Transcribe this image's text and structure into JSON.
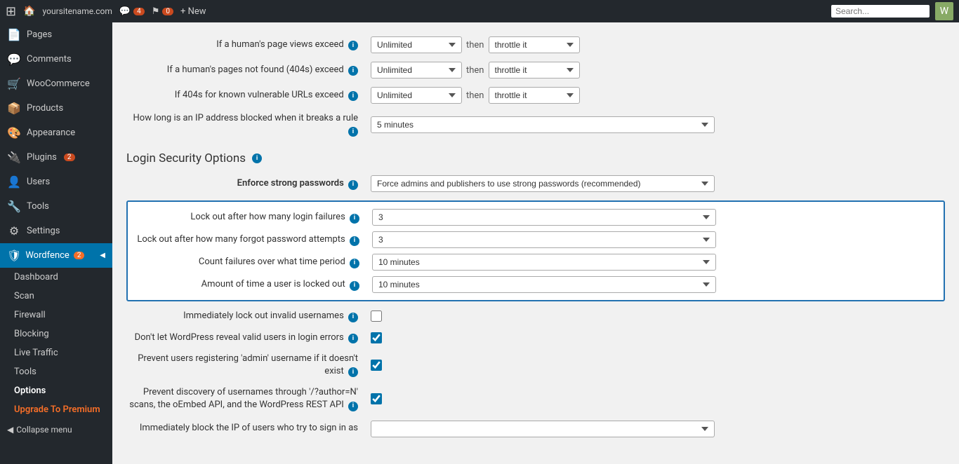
{
  "adminBar": {
    "wpLogo": "⊞",
    "siteName": "yoursitename.com",
    "commentsBubble": "4",
    "notifBubble": "0",
    "newLabel": "+ New",
    "searchPlaceholder": "Search...",
    "userDisplay": "W"
  },
  "sidebar": {
    "pages": "Pages",
    "comments": "Comments",
    "woocommerce": "WooCommerce",
    "products": "Products",
    "appearance": "Appearance",
    "plugins": "Plugins",
    "pluginsBadge": "2",
    "users": "Users",
    "tools": "Tools",
    "settings": "Settings",
    "wordfence": "Wordfence",
    "wordfenceBadge": "2",
    "subItems": [
      "Dashboard",
      "Scan",
      "Firewall",
      "Blocking",
      "Live Traffic",
      "Tools",
      "Options"
    ],
    "upgrade": "Upgrade To Premium",
    "collapse": "Collapse menu"
  },
  "page": {
    "rows": [
      {
        "label": "If a human's page views exceed",
        "hasInfo": true,
        "controlType": "select-then-select",
        "value1": "Unlimited",
        "thenLabel": "then",
        "value2": "throttle it"
      },
      {
        "label": "If a human's pages not found (404s) exceed",
        "hasInfo": true,
        "controlType": "select-then-select",
        "value1": "Unlimited",
        "thenLabel": "then",
        "value2": "throttle it"
      },
      {
        "label": "If 404s for known vulnerable URLs exceed",
        "hasInfo": true,
        "controlType": "select-then-select",
        "value1": "Unlimited",
        "thenLabel": "then",
        "value2": "throttle it"
      },
      {
        "label": "How long is an IP address blocked when it breaks a rule",
        "hasInfo": true,
        "controlType": "select-full",
        "value1": "5 minutes"
      }
    ],
    "loginSectionTitle": "Login Security Options",
    "enforceRow": {
      "label": "Enforce strong passwords",
      "hasInfo": true,
      "value": "Force admins and publishers to use strong passwords (recommended)"
    },
    "highlightedRows": [
      {
        "label": "Lock out after how many login failures",
        "hasInfo": true,
        "value": "3"
      },
      {
        "label": "Lock out after how many forgot password attempts",
        "hasInfo": true,
        "value": "3"
      },
      {
        "label": "Count failures over what time period",
        "hasInfo": true,
        "value": "10 minutes"
      },
      {
        "label": "Amount of time a user is locked out",
        "hasInfo": true,
        "value": "10 minutes"
      }
    ],
    "checkboxRows": [
      {
        "label": "Immediately lock out invalid usernames",
        "hasInfo": true,
        "checked": false
      },
      {
        "label": "Don't let WordPress reveal valid users in login errors",
        "hasInfo": true,
        "checked": true
      },
      {
        "label": "Prevent users registering 'admin' username if it doesn't exist",
        "hasInfo": true,
        "checked": true
      },
      {
        "label": "Prevent discovery of usernames through '/?author=N' scans, the oEmbed API, and the WordPress REST API",
        "hasInfo": true,
        "checked": true
      },
      {
        "label": "Immediately block the IP of users who try to sign in as",
        "hasInfo": false,
        "checked": false,
        "partial": true
      }
    ]
  }
}
